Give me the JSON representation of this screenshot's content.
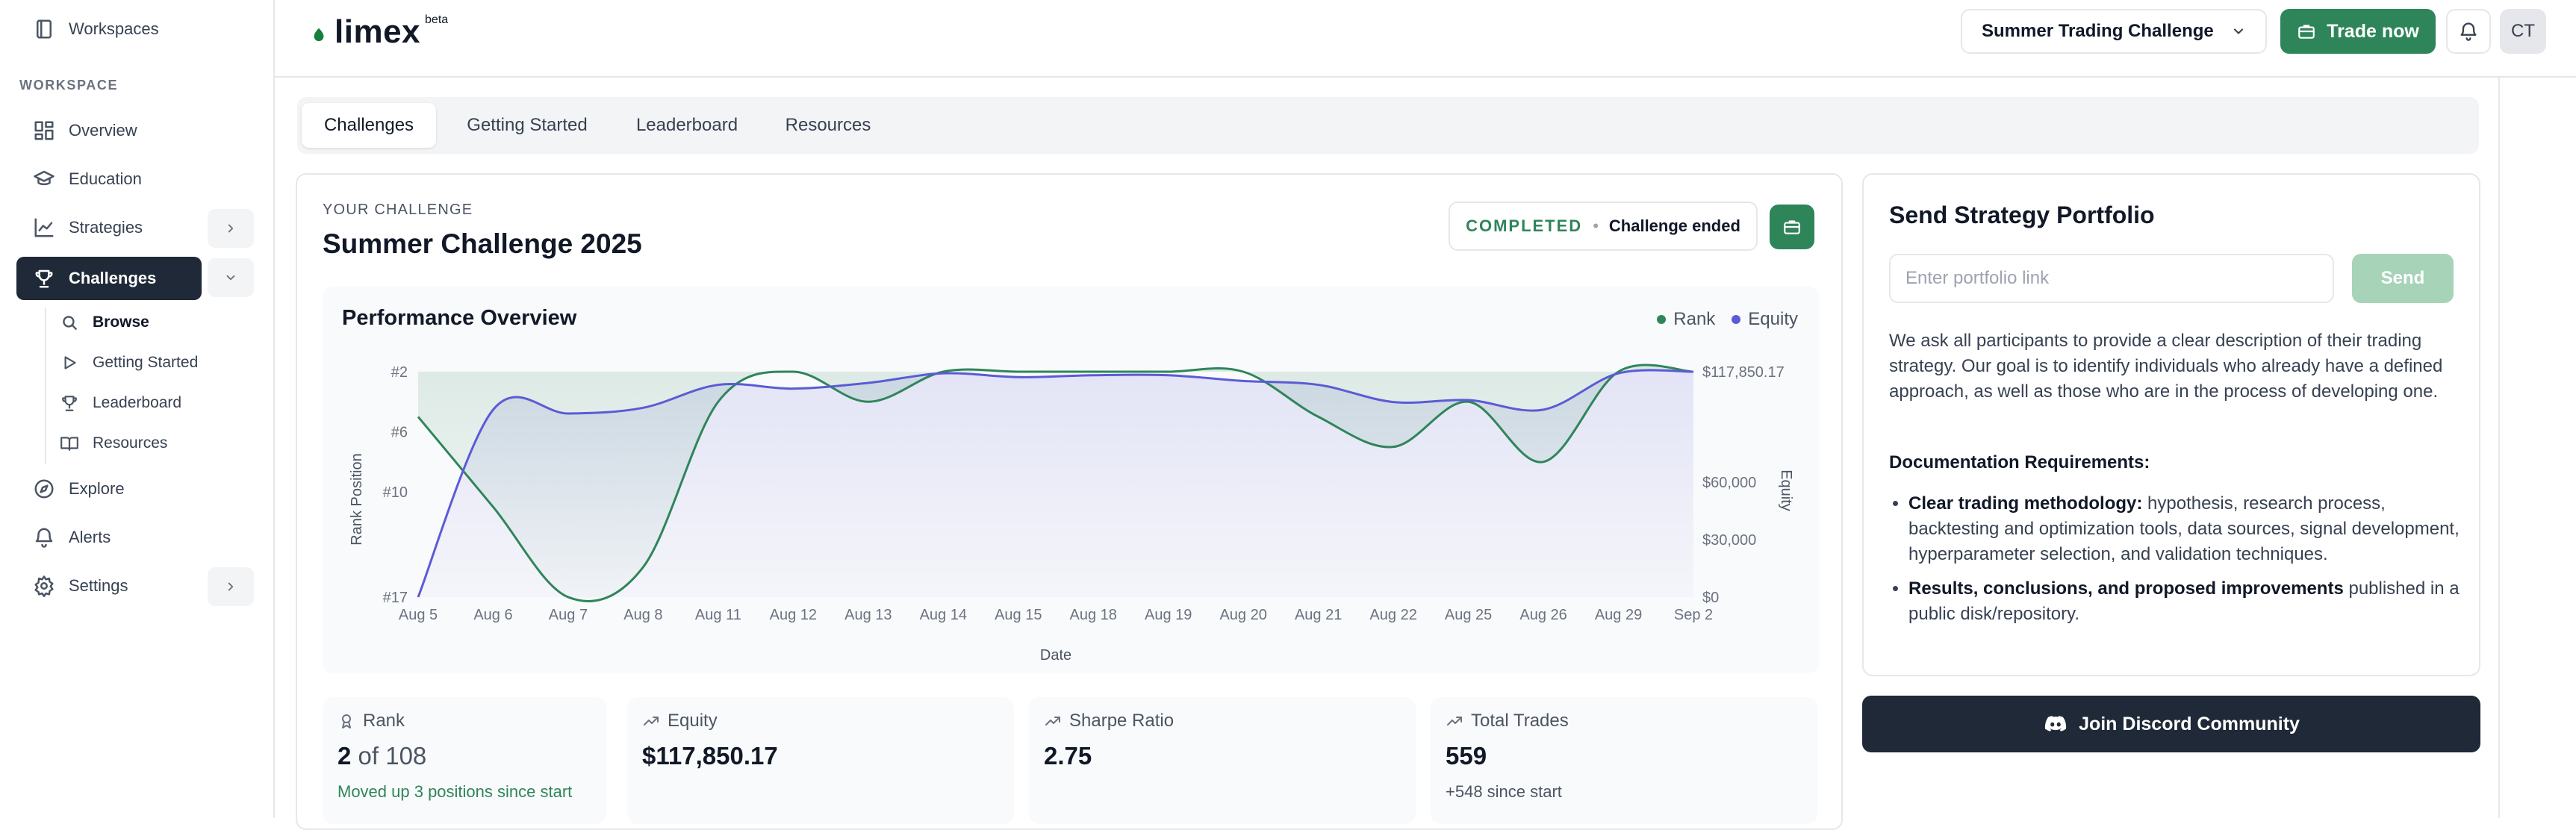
{
  "sidebar": {
    "workspaces_label": "Workspaces",
    "section_label": "WORKSPACE",
    "items": [
      {
        "label": "Overview"
      },
      {
        "label": "Education"
      },
      {
        "label": "Strategies"
      },
      {
        "label": "Challenges"
      },
      {
        "label": "Explore"
      },
      {
        "label": "Alerts"
      },
      {
        "label": "Settings"
      }
    ],
    "challenges_sub": [
      {
        "label": "Browse"
      },
      {
        "label": "Getting Started"
      },
      {
        "label": "Leaderboard"
      },
      {
        "label": "Resources"
      }
    ]
  },
  "header": {
    "logo": "limex",
    "logo_badge": "beta",
    "challenge_select": "Summer Trading Challenge",
    "trade_button": "Trade now",
    "avatar_initials": "CT"
  },
  "tabs": [
    {
      "label": "Challenges",
      "active": true
    },
    {
      "label": "Getting Started",
      "active": false
    },
    {
      "label": "Leaderboard",
      "active": false
    },
    {
      "label": "Resources",
      "active": false
    }
  ],
  "challenge": {
    "eyebrow": "YOUR CHALLENGE",
    "title": "Summer Challenge 2025",
    "status": "COMPLETED",
    "status_separator": "•",
    "status_detail": "Challenge ended"
  },
  "performance": {
    "title": "Performance Overview",
    "legend": [
      {
        "label": "Rank",
        "color": "#2f855a"
      },
      {
        "label": "Equity",
        "color": "#5b5bd6"
      }
    ]
  },
  "chart_data": {
    "type": "line",
    "xlabel": "Date",
    "ylabel_left": "Rank Position",
    "ylabel_right": "Equity",
    "x": [
      "Aug 5",
      "Aug 6",
      "Aug 7",
      "Aug 8",
      "Aug 11",
      "Aug 12",
      "Aug 13",
      "Aug 14",
      "Aug 15",
      "Aug 18",
      "Aug 19",
      "Aug 20",
      "Aug 21",
      "Aug 22",
      "Aug 25",
      "Aug 26",
      "Aug 29",
      "Sep 2"
    ],
    "rank_ticks": [
      "#2",
      "#6",
      "#10",
      "#17"
    ],
    "rank_tick_values": [
      2,
      6,
      10,
      17
    ],
    "rank_range": [
      2,
      17
    ],
    "equity_ticks": [
      "$117,850.17",
      "$60,000",
      "$30,000",
      "$0"
    ],
    "equity_tick_values": [
      117850.17,
      60000,
      30000,
      0
    ],
    "equity_range": [
      0,
      117850.17
    ],
    "series": [
      {
        "name": "Rank",
        "axis": "left",
        "color": "#2f855a",
        "values": [
          5,
          11,
          17,
          15,
          4,
          2,
          4,
          2,
          2,
          2,
          2,
          2,
          5,
          7,
          4,
          8,
          2,
          2
        ]
      },
      {
        "name": "Equity",
        "axis": "right",
        "color": "#5b5bd6",
        "values": [
          0,
          98000,
          96000,
          99000,
          111000,
          109000,
          112000,
          117000,
          115000,
          116000,
          116000,
          113000,
          111000,
          102000,
          103000,
          98000,
          117000,
          117850.17
        ]
      }
    ],
    "grid": false,
    "legend_position": "top-right"
  },
  "stats": [
    {
      "label": "Rank",
      "value": "2",
      "of_text": "of 108",
      "sub": "Moved up 3 positions since start"
    },
    {
      "label": "Equity",
      "value": "$117,850.17",
      "sub": ""
    },
    {
      "label": "Sharpe Ratio",
      "value": "2.75",
      "sub": ""
    },
    {
      "label": "Total Trades",
      "value": "559",
      "sub": "+548 since start"
    }
  ],
  "portfolio": {
    "title": "Send Strategy Portfolio",
    "placeholder": "Enter portfolio link",
    "value": "",
    "send_button": "Send",
    "description": "We ask all participants to provide a clear description of their trading strategy. Our goal is to identify individuals who already have a defined approach, as well as those who are in the process of developing one.",
    "doc_title": "Documentation Requirements:",
    "requirements": [
      {
        "bold": "Clear trading methodology:",
        "text": " hypothesis, research process, backtesting and optimization tools, data sources, signal development, hyperparameter selection, and validation techniques."
      },
      {
        "bold": "Results, conclusions, and proposed improvements",
        "text": " published in a public disk/repository."
      }
    ]
  },
  "discord_button": "Join Discord Community",
  "colors": {
    "accent": "#2f855a",
    "dark": "#1f2937",
    "equity": "#5b5bd6"
  }
}
